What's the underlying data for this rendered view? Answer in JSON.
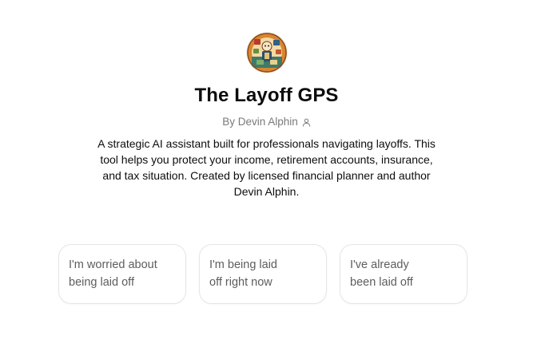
{
  "gpt": {
    "title": "The Layoff GPS",
    "author": "By Devin Alphin",
    "author_icon": "person-icon",
    "description": "A strategic AI assistant built for professionals navigating layoffs. This tool helps you protect your income, retirement accounts, insurance, and tax situation. Created by licensed financial planner and author Devin Alphin."
  },
  "starters": [
    {
      "line1": "I'm worried about",
      "line2": "being laid off"
    },
    {
      "line1": "I'm being laid",
      "line2": "off right now"
    },
    {
      "line1": "I've already",
      "line2": "been laid off"
    }
  ],
  "colors": {
    "text": "#0d0d0d",
    "muted": "#7a7a7a",
    "starter_text": "#5d5d5d",
    "border": "#e5e5e5"
  }
}
